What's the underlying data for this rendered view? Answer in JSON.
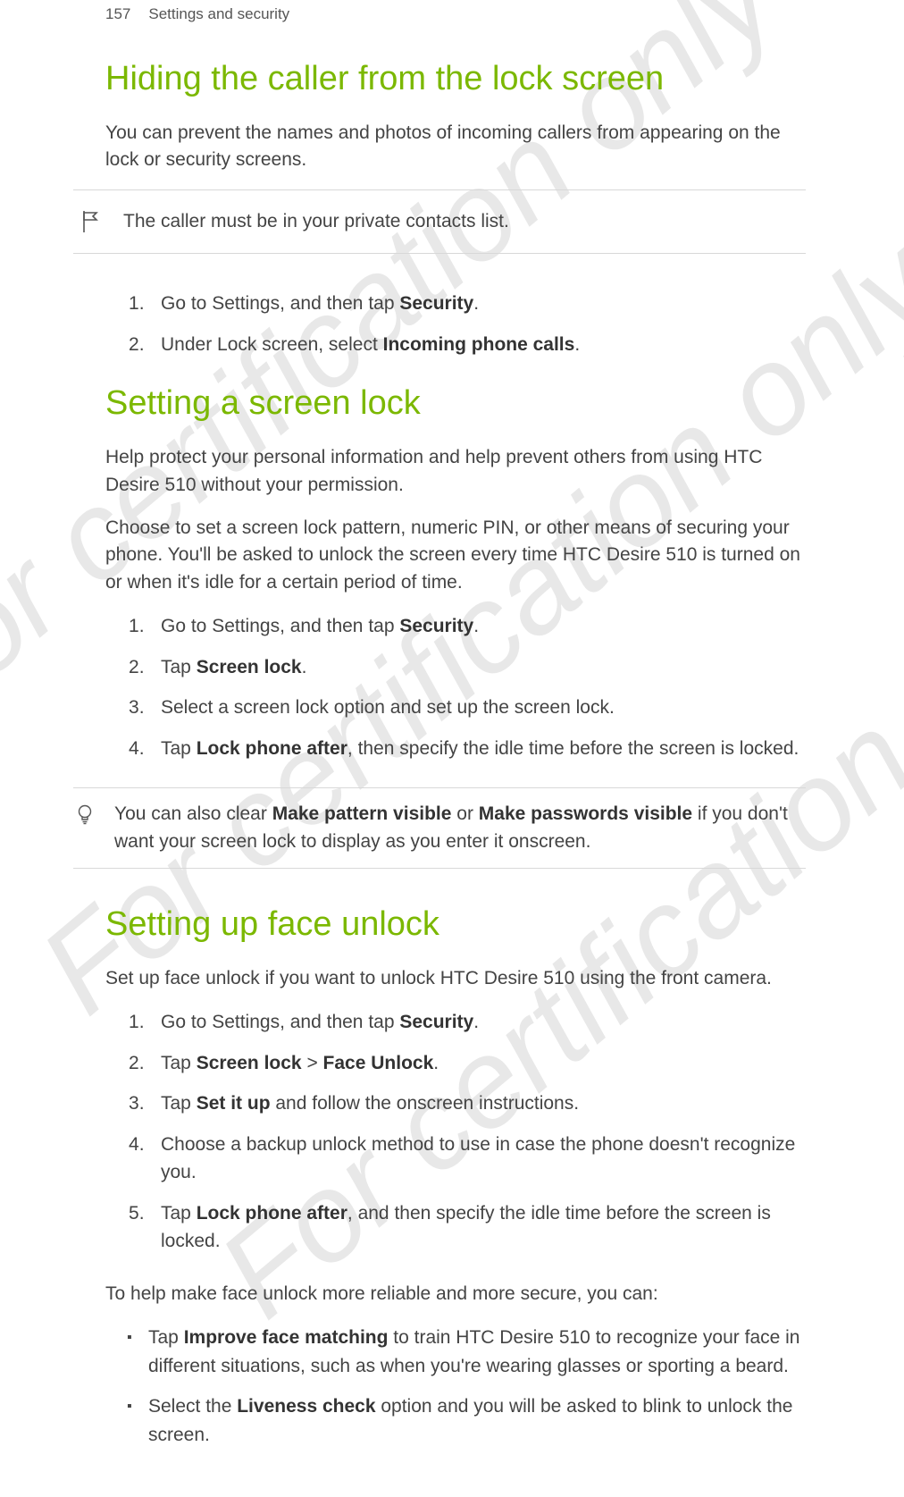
{
  "page": {
    "number": "157",
    "title": "Settings and security"
  },
  "watermarks": {
    "wm1": "For certification only",
    "wm2": "For certification only",
    "wm3": "For certification only"
  },
  "sec1": {
    "heading": "Hiding the caller from the lock screen",
    "intro": "You can prevent the names and photos of incoming callers from appearing on the lock or security screens.",
    "callout": "The caller must be in your private contacts list.",
    "steps": {
      "s1a": "Go to Settings, and then tap ",
      "s1b": "Security",
      "s1c": ".",
      "s2a": "Under Lock screen, select ",
      "s2b": "Incoming phone calls",
      "s2c": "."
    }
  },
  "sec2": {
    "heading": "Setting a screen lock",
    "p1": "Help protect your personal information and help prevent others from using HTC Desire 510 without your permission.",
    "p2": "Choose to set a screen lock pattern, numeric PIN, or other means of securing your phone. You'll be asked to unlock the screen every time HTC Desire 510 is turned on or when it's idle for a certain period of time.",
    "steps": {
      "s1a": "Go to Settings, and then tap ",
      "s1b": "Security",
      "s1c": ".",
      "s2a": "Tap ",
      "s2b": "Screen lock",
      "s2c": ".",
      "s3": "Select a screen lock option and set up the screen lock.",
      "s4a": "Tap ",
      "s4b": "Lock phone after",
      "s4c": ", then specify the idle time before the screen is locked."
    },
    "tip": {
      "a": "You can also clear ",
      "b": "Make pattern visible",
      "c": " or ",
      "d": "Make passwords visible",
      "e": " if you don't want your screen lock to display as you enter it onscreen."
    }
  },
  "sec3": {
    "heading": "Setting up face unlock",
    "intro": "Set up face unlock if you want to unlock HTC Desire 510 using the front camera.",
    "steps": {
      "s1a": "Go to Settings, and then tap ",
      "s1b": "Security",
      "s1c": ".",
      "s2a": "Tap ",
      "s2b": "Screen lock",
      "s2c": " > ",
      "s2d": "Face Unlock",
      "s2e": ".",
      "s3a": "Tap ",
      "s3b": "Set it up",
      "s3c": " and follow the onscreen instructions.",
      "s4": "Choose a backup unlock method to use in case the phone doesn't recognize you.",
      "s5a": "Tap ",
      "s5b": "Lock phone after",
      "s5c": ", and then specify the idle time before the screen is locked."
    },
    "outro": "To help make face unlock more reliable and more secure, you can:",
    "bullets": {
      "b1a": "Tap ",
      "b1b": "Improve face matching",
      "b1c": " to train HTC Desire 510 to recognize your face in different situations, such as when you're wearing glasses or sporting a beard.",
      "b2a": "Select the ",
      "b2b": "Liveness check",
      "b2c": " option and you will be asked to blink to unlock the screen."
    }
  }
}
